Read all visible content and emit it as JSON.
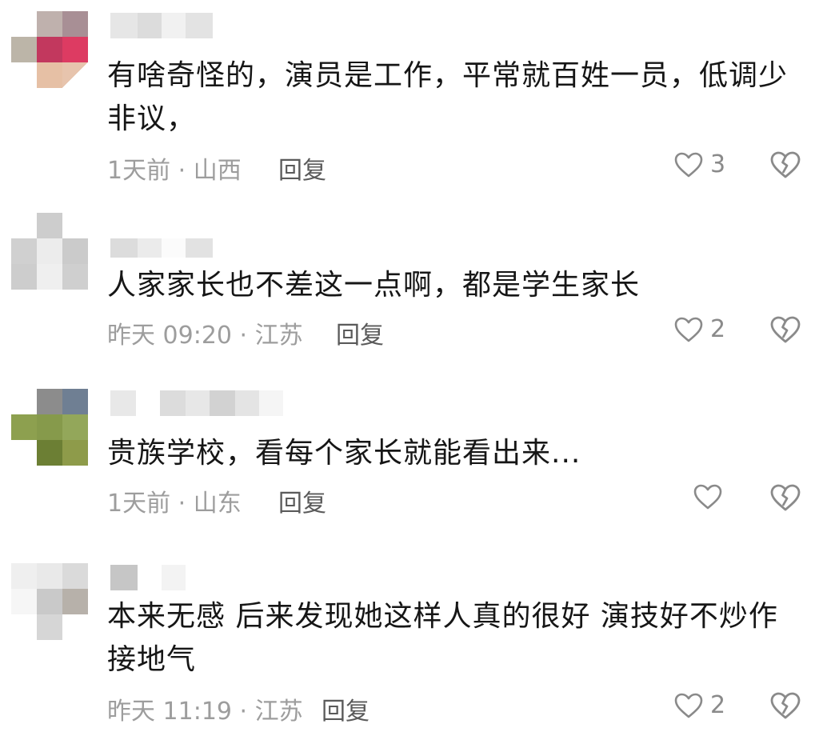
{
  "comments": [
    {
      "text": "有啥奇怪的，演员是工作，平常就百姓一员，低调少非议，",
      "time": "1天前",
      "location": "山西",
      "reply_label": "回复",
      "likes": "3"
    },
    {
      "text": "人家家长也不差这一点啊，都是学生家长",
      "time": "昨天 09:20",
      "location": "江苏",
      "reply_label": "回复",
      "likes": "2"
    },
    {
      "text": "贵族学校，看每个家长就能看出来...",
      "time": "1天前",
      "location": "山东",
      "reply_label": "回复",
      "likes": ""
    },
    {
      "text": "本来无感 后来发现她这样人真的很好 演技好不炒作接地气",
      "time": "昨天 11:19",
      "location": "江苏",
      "reply_label": "回复",
      "likes": "2"
    }
  ],
  "icons": {
    "like": "heart-outline-icon",
    "dislike": "broken-heart-icon"
  },
  "colors": {
    "text": "#161616",
    "meta": "#9d9d9d",
    "icon": "#8a8a8a"
  }
}
